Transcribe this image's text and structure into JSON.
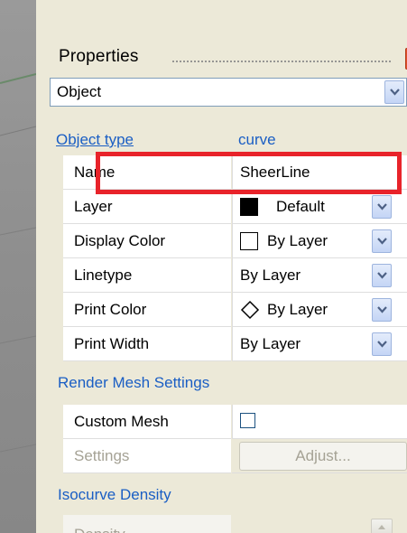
{
  "header": {
    "title": "Properties",
    "close_label": "×"
  },
  "object_dropdown": {
    "selected": "Object"
  },
  "object_type": {
    "label": "Object type",
    "value": "curve"
  },
  "properties": [
    {
      "name": "Name",
      "value": "SheerLine"
    },
    {
      "name": "Layer",
      "value": "Default"
    },
    {
      "name": "Display Color",
      "value": "By Layer"
    },
    {
      "name": "Linetype",
      "value": "By Layer"
    },
    {
      "name": "Print Color",
      "value": "By Layer"
    },
    {
      "name": "Print Width",
      "value": "By Layer"
    }
  ],
  "render_mesh": {
    "header": "Render Mesh Settings",
    "custom_mesh_label": "Custom Mesh",
    "settings_label": "Settings",
    "adjust_label": "Adjust..."
  },
  "isocurve": {
    "header": "Isocurve Density",
    "density_label": "Density"
  },
  "colors": {
    "accent_blue": "#1a5ec4",
    "highlight_red": "#e8232a",
    "close_red": "#e2502a"
  }
}
